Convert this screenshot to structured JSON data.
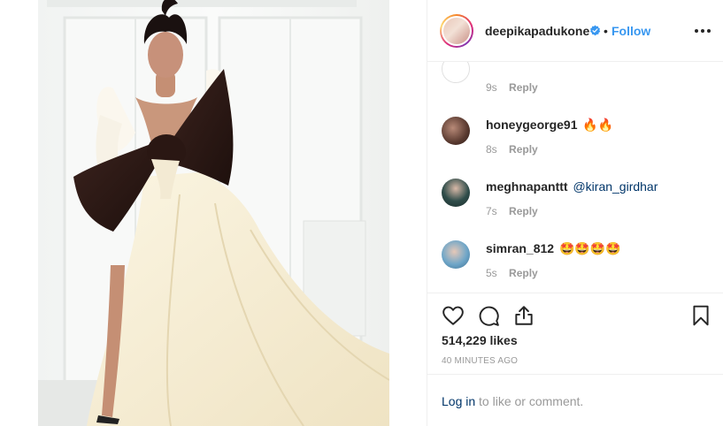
{
  "post": {
    "username": "deepikapadukone",
    "separator": "•",
    "follow_label": "Follow"
  },
  "comments": [
    {
      "username": "",
      "text": "",
      "time": "9s",
      "reply_label": "Reply"
    },
    {
      "username": "honeygeorge91",
      "text": "🔥🔥",
      "time": "8s",
      "reply_label": "Reply"
    },
    {
      "username": "meghnapanttt",
      "text": "@kiran_girdhar",
      "time": "7s",
      "reply_label": "Reply"
    },
    {
      "username": "simran_812",
      "text": "🤩🤩🤩🤩",
      "time": "5s",
      "reply_label": "Reply"
    }
  ],
  "actions": {
    "likes": "514,229 likes",
    "posted": "40 MINUTES AGO"
  },
  "login": {
    "link_label": "Log in",
    "rest_label": "to like or comment."
  },
  "colors": {
    "link_blue": "#3897f0",
    "mention": "#003569",
    "muted": "#999999",
    "text": "#262626"
  },
  "icons": [
    "verified-badge-icon",
    "more-options-icon",
    "heart-icon",
    "comment-icon",
    "share-icon",
    "bookmark-icon"
  ]
}
